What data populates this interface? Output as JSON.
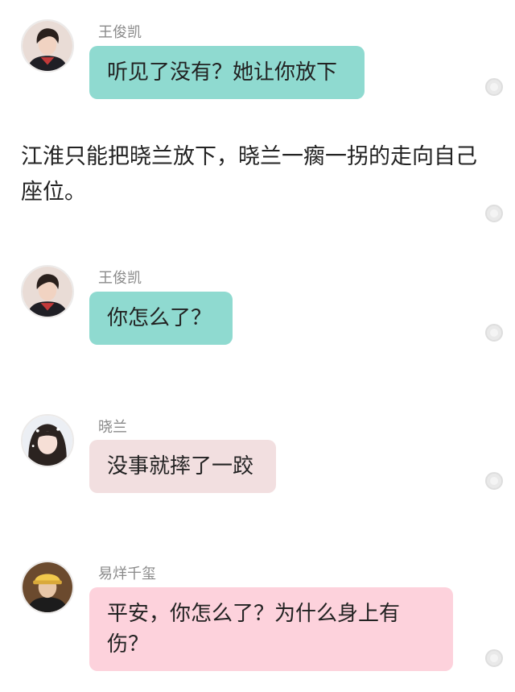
{
  "colors": {
    "bubble_teal": "#8fdad0",
    "bubble_light_pink": "#f2dfe0",
    "bubble_pink": "#fdd2dc",
    "name_gray": "#8a8a8a",
    "text": "#222222"
  },
  "messages": [
    {
      "sender": "王俊凯",
      "text": "听见了没有？她让你放下",
      "bubble_color": "#8fdad0",
      "avatar_icon": "boy-portrait-avatar"
    },
    {
      "sender": "王俊凯",
      "text": "你怎么了？",
      "bubble_color": "#8fdad0",
      "avatar_icon": "boy-portrait-avatar"
    },
    {
      "sender": "晓兰",
      "text": "没事就摔了一跤",
      "bubble_color": "#f2dfe0",
      "avatar_icon": "girl-portrait-avatar"
    },
    {
      "sender": "易烊千玺",
      "text": "平安，你怎么了？为什么身上有伤？",
      "bubble_color": "#fdd2dc",
      "avatar_icon": "boy-cap-portrait-avatar"
    }
  ],
  "narration": {
    "text": "江淮只能把晓兰放下，晓兰一瘸一拐的走向自己座位。"
  }
}
